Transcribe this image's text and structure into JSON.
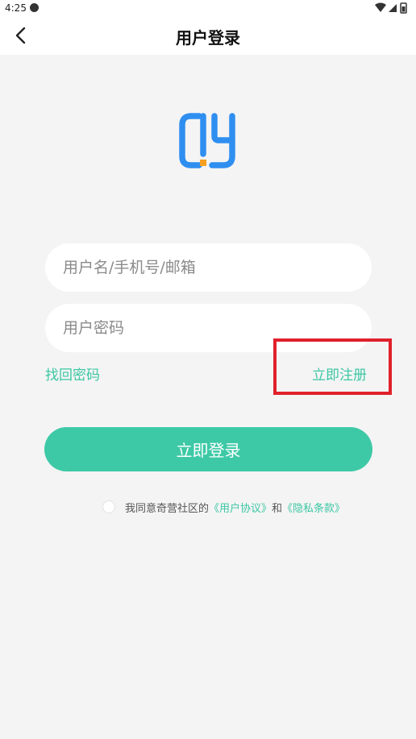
{
  "status_bar": {
    "time": "4:25",
    "icons": [
      "wifi-icon",
      "signal-icon",
      "battery-icon"
    ]
  },
  "nav": {
    "title": "用户登录",
    "back_icon": "chevron-left-icon"
  },
  "logo": {
    "icon": "app-logo",
    "colors": {
      "primary": "#2f8ff0",
      "accent": "#f5a020"
    }
  },
  "form": {
    "username_placeholder": "用户名/手机号/邮箱",
    "username_value": "",
    "password_placeholder": "用户密码",
    "password_value": ""
  },
  "links": {
    "forgot_password": "找回密码",
    "register": "立即注册"
  },
  "login_button": "立即登录",
  "agreement": {
    "prefix": "我同意奇营社区的",
    "user_agreement": "《用户协议》",
    "conjunction": "和",
    "privacy_policy": "《隐私条款》",
    "checked": false
  },
  "colors": {
    "accent": "#3ec9a6",
    "highlight": "#e0212c",
    "background": "#f4f4f4"
  }
}
